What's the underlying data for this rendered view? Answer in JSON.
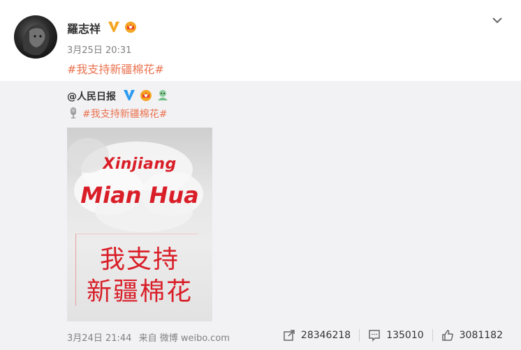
{
  "post": {
    "username": "羅志祥",
    "time": "3月25日 20:31",
    "topic": "#我支持新疆棉花#",
    "icons": [
      "vip-v-icon",
      "crown-icon",
      "chevron-down-icon"
    ]
  },
  "repost": {
    "author": "@人民日报",
    "topic": "#我支持新疆棉花#",
    "icons": [
      "verified-v-icon",
      "crown-icon",
      "badge-icon",
      "microphone-icon"
    ],
    "poster": {
      "line1": "Xinjiang",
      "line2": "Mian Hua",
      "cn_line1": "我支持",
      "cn_line2": "新疆棉花"
    },
    "meta": {
      "time": "3月24日 21:44",
      "from": "来自 微博 weibo.com"
    },
    "stats": {
      "repost": "28346218",
      "comment": "135010",
      "like": "3081182"
    }
  },
  "colors": {
    "topic": "#eb7350",
    "repost_bg": "#f2f2f5",
    "poster_red": "#d91e28",
    "vip_gold": "#f5a623",
    "verified_blue": "#2d9bf0"
  }
}
